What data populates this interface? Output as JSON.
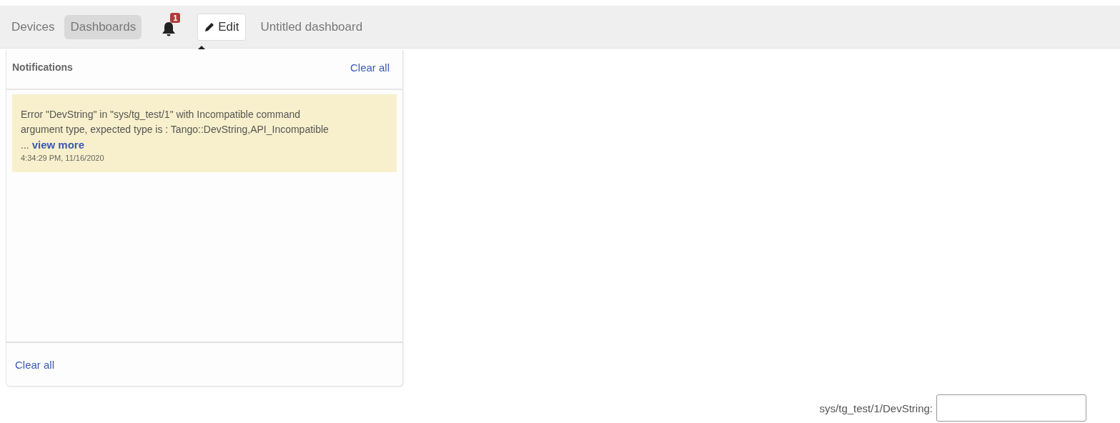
{
  "nav": [
    {
      "label": "Devices",
      "selected": false
    },
    {
      "label": "Dashboards",
      "selected": true
    }
  ],
  "notification_badge": "1",
  "edit_button": "Edit",
  "dashboard_title": "Untitled dashboard",
  "notifications_panel": {
    "title": "Notifications",
    "clear_all_top": "Clear all",
    "items": [
      {
        "message": "Error \"DevString\" in \"sys/tg_test/1\" with Incompatible command argument type, expected type is : Tango::DevString,API_Incompatible ...",
        "link": "view more",
        "time": "4:34:29 PM, 11/16/2020"
      }
    ],
    "clear_all_bottom": "Clear all"
  },
  "widget": {
    "label": "sys/tg_test/1/DevString:"
  }
}
